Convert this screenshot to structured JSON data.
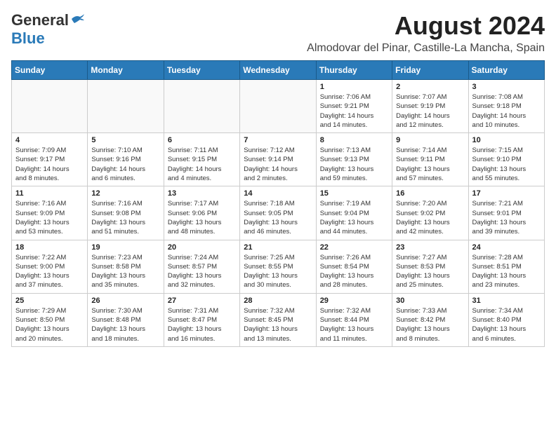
{
  "header": {
    "logo_general": "General",
    "logo_blue": "Blue",
    "title": "August 2024",
    "subtitle": "Almodovar del Pinar, Castille-La Mancha, Spain"
  },
  "days_of_week": [
    "Sunday",
    "Monday",
    "Tuesday",
    "Wednesday",
    "Thursday",
    "Friday",
    "Saturday"
  ],
  "weeks": [
    [
      {
        "day": "",
        "info": ""
      },
      {
        "day": "",
        "info": ""
      },
      {
        "day": "",
        "info": ""
      },
      {
        "day": "",
        "info": ""
      },
      {
        "day": "1",
        "info": "Sunrise: 7:06 AM\nSunset: 9:21 PM\nDaylight: 14 hours\nand 14 minutes."
      },
      {
        "day": "2",
        "info": "Sunrise: 7:07 AM\nSunset: 9:19 PM\nDaylight: 14 hours\nand 12 minutes."
      },
      {
        "day": "3",
        "info": "Sunrise: 7:08 AM\nSunset: 9:18 PM\nDaylight: 14 hours\nand 10 minutes."
      }
    ],
    [
      {
        "day": "4",
        "info": "Sunrise: 7:09 AM\nSunset: 9:17 PM\nDaylight: 14 hours\nand 8 minutes."
      },
      {
        "day": "5",
        "info": "Sunrise: 7:10 AM\nSunset: 9:16 PM\nDaylight: 14 hours\nand 6 minutes."
      },
      {
        "day": "6",
        "info": "Sunrise: 7:11 AM\nSunset: 9:15 PM\nDaylight: 14 hours\nand 4 minutes."
      },
      {
        "day": "7",
        "info": "Sunrise: 7:12 AM\nSunset: 9:14 PM\nDaylight: 14 hours\nand 2 minutes."
      },
      {
        "day": "8",
        "info": "Sunrise: 7:13 AM\nSunset: 9:13 PM\nDaylight: 13 hours\nand 59 minutes."
      },
      {
        "day": "9",
        "info": "Sunrise: 7:14 AM\nSunset: 9:11 PM\nDaylight: 13 hours\nand 57 minutes."
      },
      {
        "day": "10",
        "info": "Sunrise: 7:15 AM\nSunset: 9:10 PM\nDaylight: 13 hours\nand 55 minutes."
      }
    ],
    [
      {
        "day": "11",
        "info": "Sunrise: 7:16 AM\nSunset: 9:09 PM\nDaylight: 13 hours\nand 53 minutes."
      },
      {
        "day": "12",
        "info": "Sunrise: 7:16 AM\nSunset: 9:08 PM\nDaylight: 13 hours\nand 51 minutes."
      },
      {
        "day": "13",
        "info": "Sunrise: 7:17 AM\nSunset: 9:06 PM\nDaylight: 13 hours\nand 48 minutes."
      },
      {
        "day": "14",
        "info": "Sunrise: 7:18 AM\nSunset: 9:05 PM\nDaylight: 13 hours\nand 46 minutes."
      },
      {
        "day": "15",
        "info": "Sunrise: 7:19 AM\nSunset: 9:04 PM\nDaylight: 13 hours\nand 44 minutes."
      },
      {
        "day": "16",
        "info": "Sunrise: 7:20 AM\nSunset: 9:02 PM\nDaylight: 13 hours\nand 42 minutes."
      },
      {
        "day": "17",
        "info": "Sunrise: 7:21 AM\nSunset: 9:01 PM\nDaylight: 13 hours\nand 39 minutes."
      }
    ],
    [
      {
        "day": "18",
        "info": "Sunrise: 7:22 AM\nSunset: 9:00 PM\nDaylight: 13 hours\nand 37 minutes."
      },
      {
        "day": "19",
        "info": "Sunrise: 7:23 AM\nSunset: 8:58 PM\nDaylight: 13 hours\nand 35 minutes."
      },
      {
        "day": "20",
        "info": "Sunrise: 7:24 AM\nSunset: 8:57 PM\nDaylight: 13 hours\nand 32 minutes."
      },
      {
        "day": "21",
        "info": "Sunrise: 7:25 AM\nSunset: 8:55 PM\nDaylight: 13 hours\nand 30 minutes."
      },
      {
        "day": "22",
        "info": "Sunrise: 7:26 AM\nSunset: 8:54 PM\nDaylight: 13 hours\nand 28 minutes."
      },
      {
        "day": "23",
        "info": "Sunrise: 7:27 AM\nSunset: 8:53 PM\nDaylight: 13 hours\nand 25 minutes."
      },
      {
        "day": "24",
        "info": "Sunrise: 7:28 AM\nSunset: 8:51 PM\nDaylight: 13 hours\nand 23 minutes."
      }
    ],
    [
      {
        "day": "25",
        "info": "Sunrise: 7:29 AM\nSunset: 8:50 PM\nDaylight: 13 hours\nand 20 minutes."
      },
      {
        "day": "26",
        "info": "Sunrise: 7:30 AM\nSunset: 8:48 PM\nDaylight: 13 hours\nand 18 minutes."
      },
      {
        "day": "27",
        "info": "Sunrise: 7:31 AM\nSunset: 8:47 PM\nDaylight: 13 hours\nand 16 minutes."
      },
      {
        "day": "28",
        "info": "Sunrise: 7:32 AM\nSunset: 8:45 PM\nDaylight: 13 hours\nand 13 minutes."
      },
      {
        "day": "29",
        "info": "Sunrise: 7:32 AM\nSunset: 8:44 PM\nDaylight: 13 hours\nand 11 minutes."
      },
      {
        "day": "30",
        "info": "Sunrise: 7:33 AM\nSunset: 8:42 PM\nDaylight: 13 hours\nand 8 minutes."
      },
      {
        "day": "31",
        "info": "Sunrise: 7:34 AM\nSunset: 8:40 PM\nDaylight: 13 hours\nand 6 minutes."
      }
    ]
  ]
}
